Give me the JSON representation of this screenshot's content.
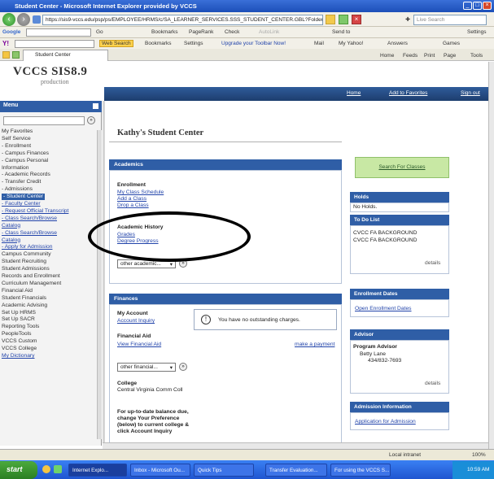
{
  "window": {
    "title": "Student Center - Microsoft Internet Explorer provided by VCCS"
  },
  "address": {
    "url": "https://sis9-vccs.edu/psp/ps/EMPLOYEE/HRMS/c/SA_LEARNER_SERVICES.SSS_STUDENT_CENTER.GBL?FolderPath=PORTAL_ROOT_OBJECT",
    "search_placeholder": "Live Search"
  },
  "google_bar": {
    "label": "Google",
    "items": [
      "Go",
      "Bookmarks",
      "PageRank",
      "Check",
      "AutoLink",
      "Send to",
      "Settings"
    ]
  },
  "yahoo_bar": {
    "label": "Y!",
    "search_label": "Web Search",
    "items": [
      "Bookmarks",
      "Settings",
      "Upgrade your Toolbar Now!",
      "Mail",
      "My Yahoo!",
      "Answers",
      "Games"
    ]
  },
  "favorites_bar": {
    "tab_label": "Student Center",
    "tools": [
      "Home",
      "Feeds",
      "Print",
      "Page",
      "Tools"
    ]
  },
  "header": {
    "logo": "VCCS SIS8.9",
    "logo_sub": "production",
    "links": [
      "Home",
      "Add to Favorites",
      "Sign out"
    ]
  },
  "menu": {
    "title": "Menu",
    "items": [
      {
        "label": "My Favorites",
        "type": "text"
      },
      {
        "label": "Self Service",
        "type": "text"
      },
      {
        "label": "- Enrollment",
        "type": "text"
      },
      {
        "label": "- Campus Finances",
        "type": "text"
      },
      {
        "label": "- Campus Personal",
        "type": "text"
      },
      {
        "label": "  Information",
        "type": "text"
      },
      {
        "label": "- Academic Records",
        "type": "text"
      },
      {
        "label": "- Transfer Credit",
        "type": "text"
      },
      {
        "label": "- Admissions",
        "type": "text"
      },
      {
        "label": "- Student Center",
        "type": "sel"
      },
      {
        "label": "- Faculty Center",
        "type": "link"
      },
      {
        "label": "- Request Official Transcript",
        "type": "link"
      },
      {
        "label": "- Class Search/Browse",
        "type": "link"
      },
      {
        "label": "  Catalog",
        "type": "link"
      },
      {
        "label": "- Class Search/Browse",
        "type": "link"
      },
      {
        "label": "  Catalog",
        "type": "link"
      },
      {
        "label": "- Apply for Admission",
        "type": "link"
      },
      {
        "label": "Campus Community",
        "type": "text"
      },
      {
        "label": "Student Recruiting",
        "type": "text"
      },
      {
        "label": "Student Admissions",
        "type": "text"
      },
      {
        "label": "Records and Enrollment",
        "type": "text"
      },
      {
        "label": "Curriculum Management",
        "type": "text"
      },
      {
        "label": "Financial Aid",
        "type": "text"
      },
      {
        "label": "Student Financials",
        "type": "text"
      },
      {
        "label": "Academic Advising",
        "type": "text"
      },
      {
        "label": "Set Up HRMS",
        "type": "text"
      },
      {
        "label": "Set Up SACR",
        "type": "text"
      },
      {
        "label": "Reporting Tools",
        "type": "text"
      },
      {
        "label": "PeopleTools",
        "type": "text"
      },
      {
        "label": "VCCS Custom",
        "type": "text"
      },
      {
        "label": "VCCS College",
        "type": "text"
      },
      {
        "label": "My Dictionary",
        "type": "link"
      }
    ]
  },
  "main": {
    "title": "Kathy's Student Center",
    "academics": {
      "header": "Academics",
      "enrollment_label": "Enrollment",
      "enrollment_links": [
        "My Class Schedule",
        "Add a Class",
        "Drop a Class"
      ],
      "history_label": "Academic History",
      "history_links": [
        "Grades",
        "Degree Progress"
      ],
      "dropdown": "other academic..."
    },
    "finances": {
      "header": "Finances",
      "account_label": "My Account",
      "account_links": [
        "Account Inquiry"
      ],
      "message": "You have no outstanding charges.",
      "aid_label": "Financial Aid",
      "aid_links": [
        "View Financial Aid"
      ],
      "payment_link": "make a payment",
      "dropdown": "other financial...",
      "college_label": "College",
      "college_value": "Central Virginia Comm Coll",
      "note": [
        "For up-to-date balance due,",
        "change Your Preference",
        "(below) to current college &",
        "click Account Inquiry"
      ]
    }
  },
  "right": {
    "search_button": "Search For Classes",
    "holds": {
      "header": "Holds",
      "text": "No Holds."
    },
    "todo": {
      "header": "To Do List",
      "items": [
        "CVCC FA BACKGROUND",
        "CVCC FA BACKGROUND"
      ],
      "details": "details"
    },
    "enrollment_dates": {
      "header": "Enrollment Dates",
      "link": "Open Enrollment Dates"
    },
    "advisor": {
      "header": "Advisor",
      "program_label": "Program Advisor",
      "name": "Betty Lane",
      "phone": "434/832-7693",
      "details": "details"
    },
    "admission": {
      "header": "Admission Information",
      "link": "Application for Admission"
    }
  },
  "statusbar": {
    "zone": "Local intranet",
    "zoom": "100%"
  },
  "taskbar": {
    "start": "start",
    "tasks": [
      "Internet Explo...",
      "Inbox - Microsoft Ou...",
      "Quick Tips",
      "Transfer Evaluation...",
      "For using the VCCS S..."
    ],
    "clock": "10:59 AM"
  }
}
